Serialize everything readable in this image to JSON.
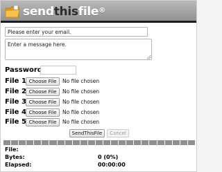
{
  "header": {
    "brand_send": "send",
    "brand_this": "this",
    "brand_file": "file",
    "brand_reg": "®",
    "logo_icon": "folder-icon",
    "colors": {
      "header_bg": "#9f9f9f",
      "header_bar": "#1c1c1c",
      "brand_text": "#ffffff",
      "brand_accent": "#2c2c2c"
    }
  },
  "form": {
    "email_placeholder": "Please enter your email.",
    "message_placeholder": "Enter a message here.",
    "password_label": "Password",
    "password_value": ""
  },
  "files": [
    {
      "label": "File 1",
      "button": "Choose File",
      "status": "No file chosen"
    },
    {
      "label": "File 2",
      "button": "Choose File",
      "status": "No file chosen"
    },
    {
      "label": "File 3",
      "button": "Choose File",
      "status": "No file chosen"
    },
    {
      "label": "File 4",
      "button": "Choose File",
      "status": "No file chosen"
    },
    {
      "label": "File 5",
      "button": "Choose File",
      "status": "No file chosen"
    }
  ],
  "actions": {
    "send_label": "SendThisFile",
    "cancel_label": "Cancel"
  },
  "progress": {
    "fraction": 0
  },
  "status": {
    "file_label": "File:",
    "file_value": "",
    "bytes_label": "Bytes:",
    "bytes_value": "0 (0%)",
    "elapsed_label": "Elapsed:",
    "elapsed_value": "00:00:00"
  }
}
